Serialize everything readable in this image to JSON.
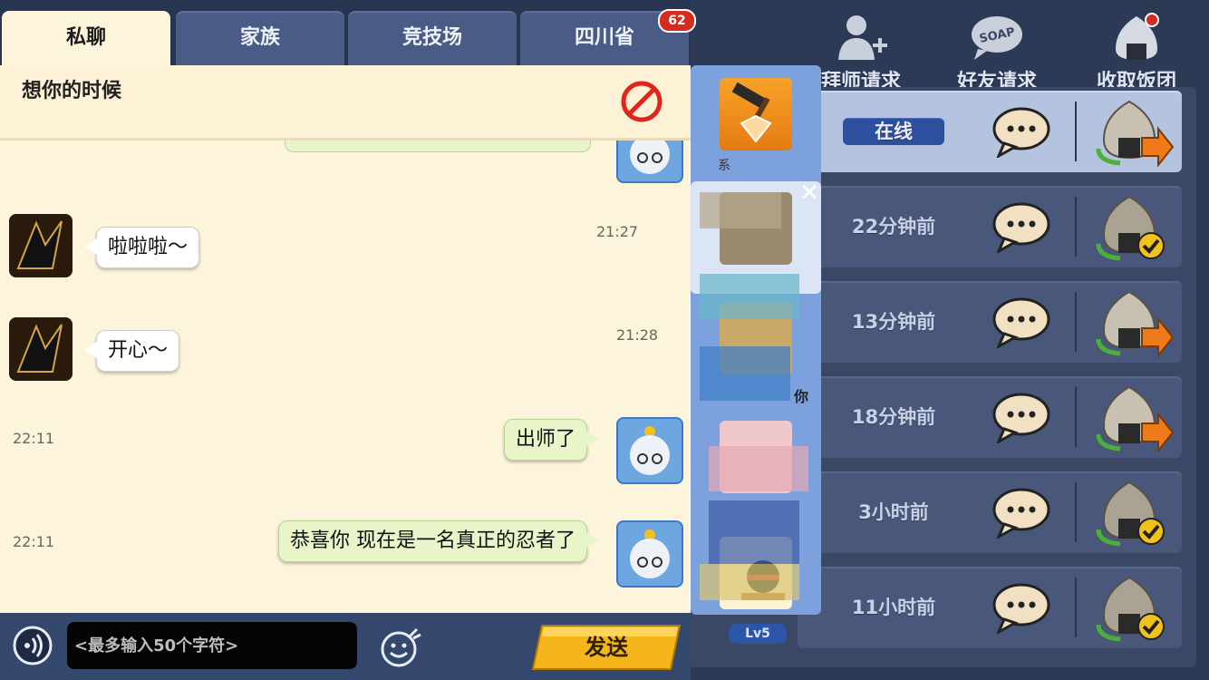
{
  "tabs": [
    {
      "label": "私聊",
      "active": true
    },
    {
      "label": "家族",
      "active": false
    },
    {
      "label": "竞技场",
      "active": false
    },
    {
      "label": "四川省",
      "active": false,
      "badge": "62"
    }
  ],
  "signature": {
    "text": "想你的时候",
    "icon": "ban-icon"
  },
  "messages": [
    {
      "time": "21:27",
      "text": "啦啦啦～",
      "direction": "in"
    },
    {
      "time": "21:28",
      "text": "开心～",
      "direction": "in"
    },
    {
      "time": "22:11",
      "text": "出师了",
      "direction": "out"
    },
    {
      "time": "22:11",
      "text": "恭喜你 现在是一名真正的忍者了",
      "direction": "out"
    }
  ],
  "input": {
    "placeholder": "<最多输入50个字符>",
    "value": "",
    "send_label": "发送"
  },
  "top_actions": [
    {
      "label": "拜师请求",
      "icon": "add-person-icon"
    },
    {
      "label": "好友请求",
      "icon": "soap-icon"
    },
    {
      "label": "收取饭团",
      "icon": "onigiri-icon"
    }
  ],
  "friends": [
    {
      "status": "在线",
      "online": true,
      "rice_state": "send"
    },
    {
      "status": "22分钟前",
      "online": false,
      "rice_state": "sent"
    },
    {
      "status": "13分钟前",
      "online": false,
      "rice_state": "send"
    },
    {
      "status": "18分钟前",
      "online": false,
      "rice_state": "send"
    },
    {
      "status": "3小时前",
      "online": false,
      "rice_state": "sent"
    },
    {
      "status": "11小时前",
      "online": false,
      "rice_state": "sent"
    }
  ],
  "side_menu": {
    "level": "Lv5",
    "partial_labels": [
      "系",
      "你"
    ]
  },
  "colors": {
    "cream_bg": "#fdf4dc",
    "tab_blue": "#4a5c85",
    "send_yellow": "#f4b61b",
    "badge_red": "#d62c20",
    "online_blue": "#2c4f9e"
  }
}
